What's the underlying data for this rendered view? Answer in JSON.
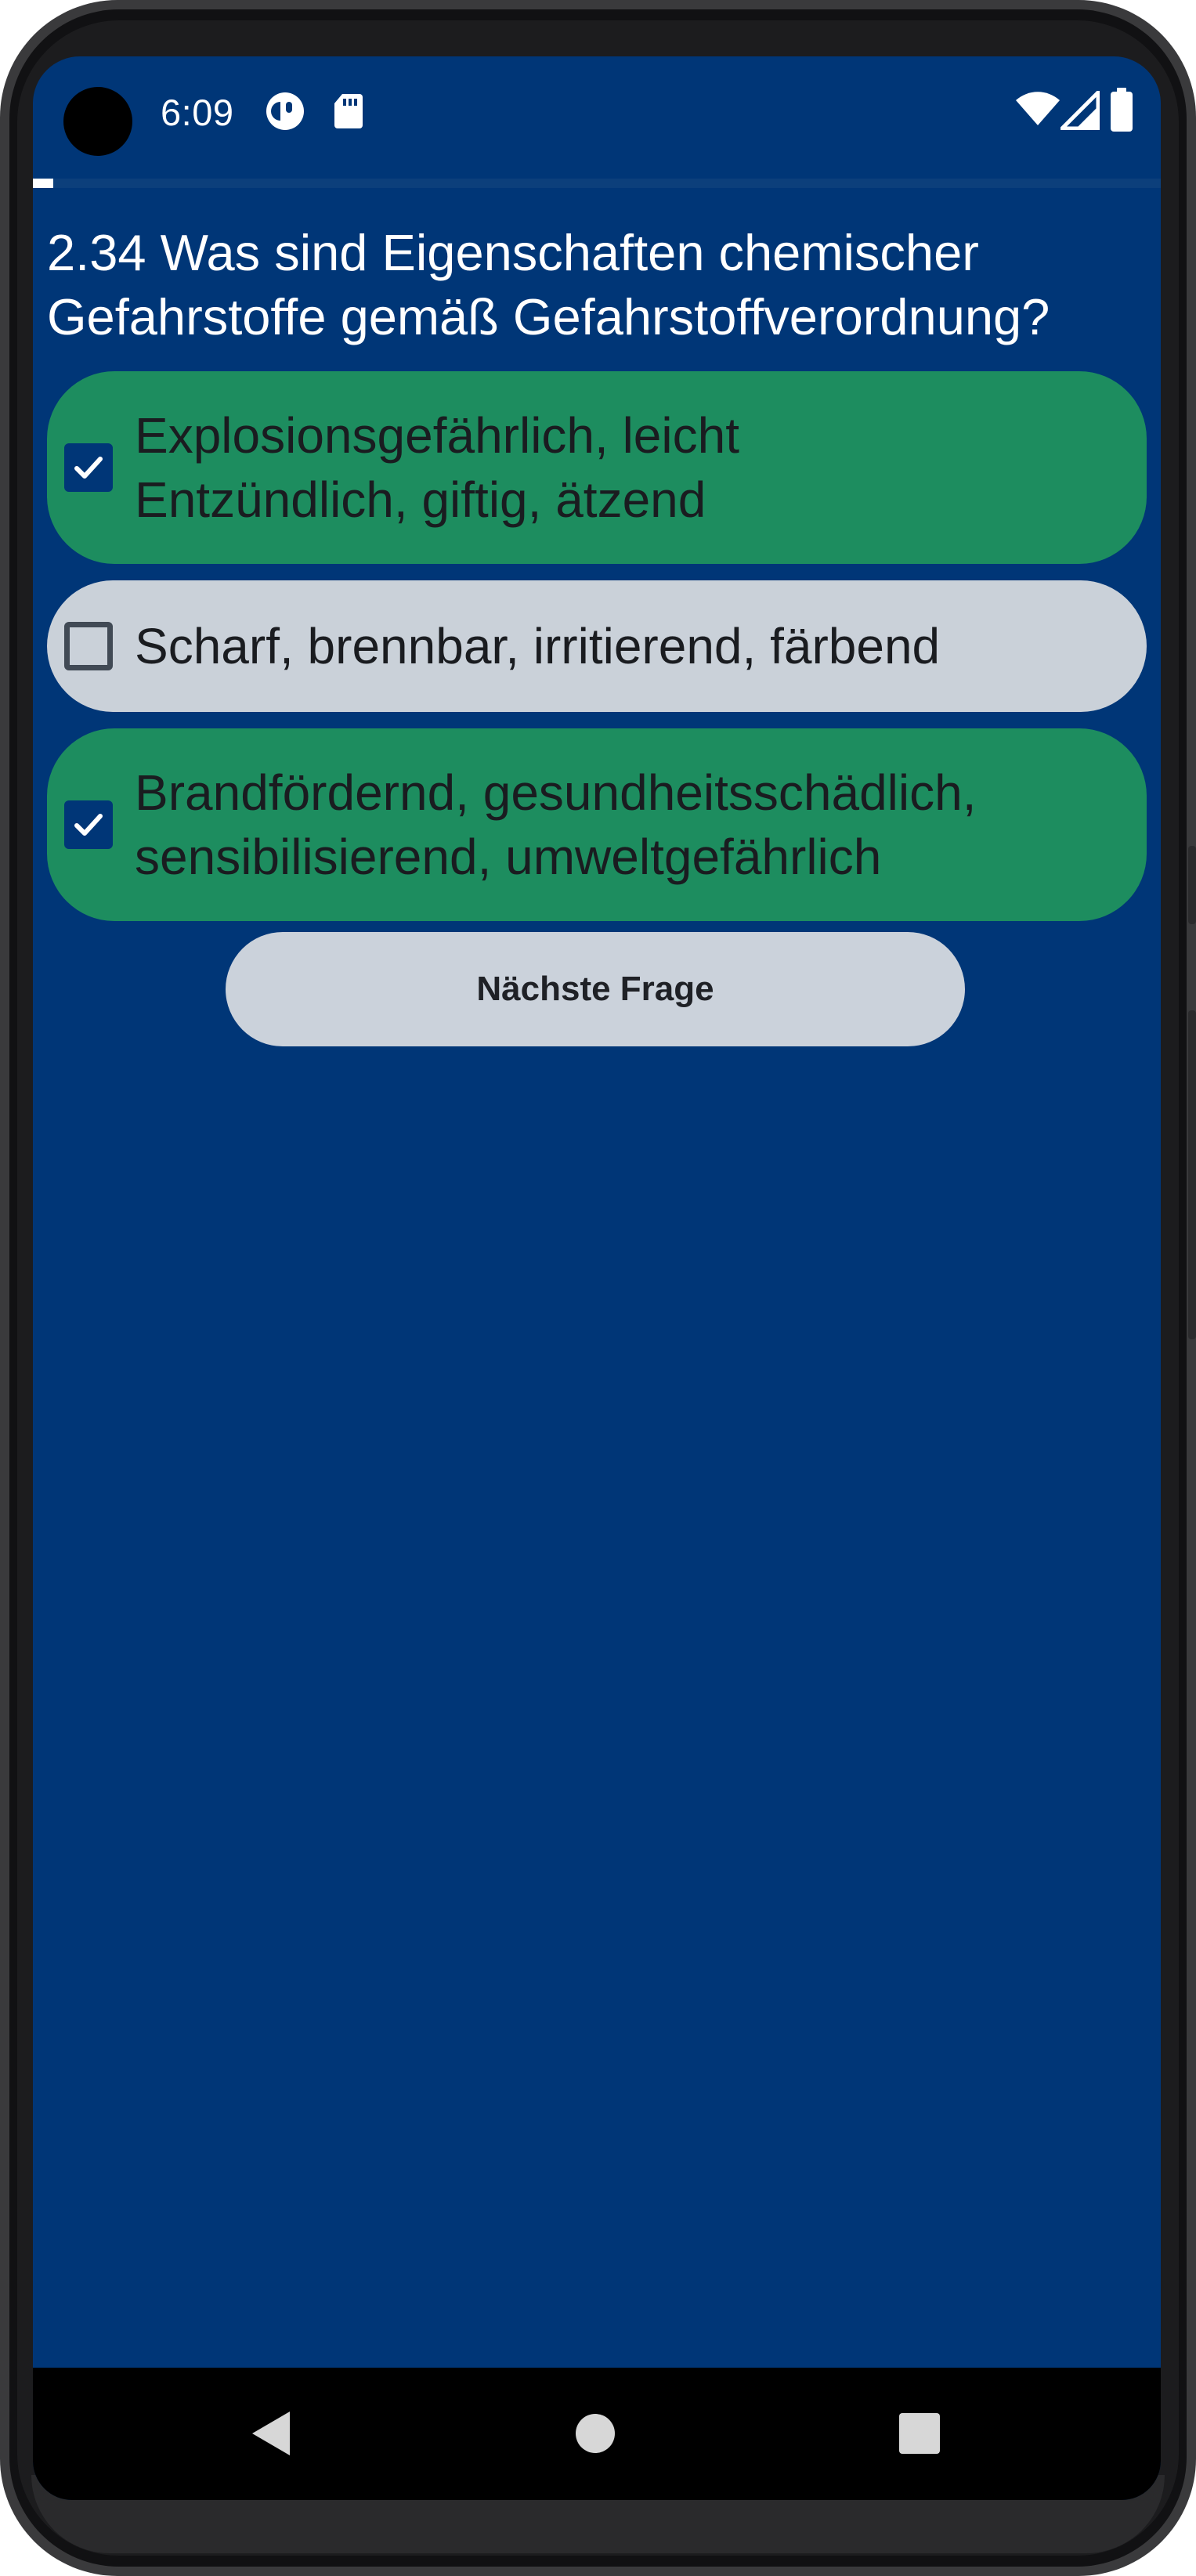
{
  "status_bar": {
    "time": "6:09",
    "icons": [
      "privacy-indicator-icon",
      "sd-card-icon",
      "wifi-icon",
      "cellular-signal-icon",
      "battery-icon"
    ]
  },
  "progress": {
    "fraction": 0.018,
    "color": "#ffffff"
  },
  "quiz": {
    "question": "2.34 Was sind Eigenschaften chemischer Gefahrstoffe gemäß Gefahrstoffverordnung?",
    "options": [
      {
        "line1": "Explosionsgefährlich, leicht",
        "line2": "Entzündlich, giftig, ätzend",
        "checked": true
      },
      {
        "line1": "Scharf, brennbar, irritierend, färbend",
        "line2": "",
        "checked": false
      },
      {
        "line1": "Brandfördernd, gesundheitsschädlich,",
        "line2": "sensibilisierend, umweltgefährlich",
        "checked": true
      }
    ],
    "next_button_label": "Nächste Frage"
  },
  "nav_bar": {
    "icons": [
      "back-icon",
      "home-icon",
      "recents-icon"
    ]
  },
  "colors": {
    "screen_background": "#003677",
    "correct_option": "#1d8d5f",
    "neutral_option": "#cad1d9",
    "button": "#cbd2db"
  }
}
